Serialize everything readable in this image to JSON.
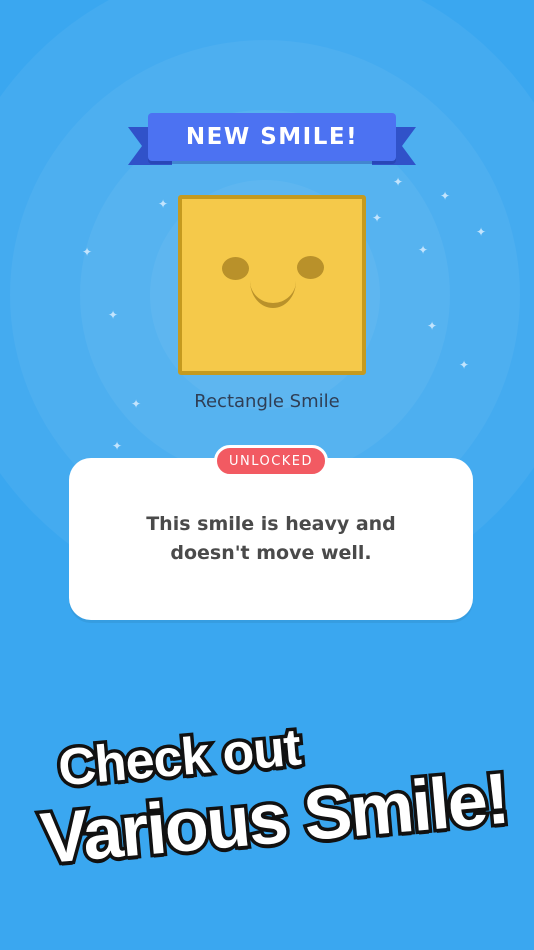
{
  "banner": {
    "title": "NEW SMILE!"
  },
  "smile": {
    "name": "Rectangle Smile",
    "color": "#f5c94a"
  },
  "card": {
    "badge": "UNLOCKED",
    "description": "This smile is heavy and doesn't move well."
  },
  "promo": {
    "line1": "Check out",
    "line2": "Various Smile!"
  },
  "colors": {
    "background": "#3aa7f0",
    "ribbon": "#4c72f2",
    "badge": "#f25a62"
  }
}
